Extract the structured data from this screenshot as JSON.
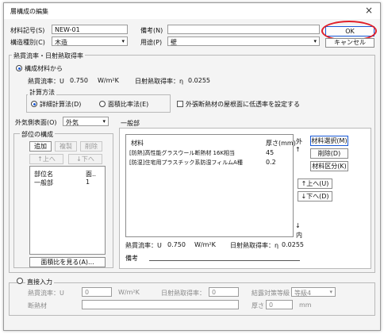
{
  "dialog": {
    "title": "層構成の編集",
    "close_glyph": "×"
  },
  "header": {
    "material_id_label": "材料記号(S)",
    "material_id_value": "NEW-01",
    "notes_label": "備考(N)",
    "notes_value": "",
    "structure_label": "構造種別(C)",
    "structure_value": "木造",
    "usage_label": "用途(P)",
    "usage_value": "壁",
    "ok_label": "OK",
    "cancel_label": "キャンセル"
  },
  "thermal": {
    "group_label": "熱貫流率・日射熱取得率",
    "from_composition_label": "構成材料から",
    "u_label": "熱貫流率：U",
    "u_value": "0.750",
    "u_unit": "W/m²K",
    "eta_label": "日射熱取得率：η",
    "eta_value": "0.0255",
    "calc_group_label": "計算方法",
    "calc_detail_label": "詳細計算法(D)",
    "calc_area_label": "面積比率法(E)",
    "low_perm_label": "外張断熱材の屋根面に低透率を設定する",
    "exterior_label": "外気側表面(O)",
    "exterior_value": "外気"
  },
  "parts": {
    "group_label": "部位の構成",
    "add_label": "追加",
    "copy_label": "複製",
    "delete_label": "削除",
    "up_label": "↑上へ",
    "down_label": "↓下へ",
    "col_name": "部位名",
    "col_area": "面..",
    "rows": [
      {
        "name": "一般部",
        "area": "1"
      }
    ],
    "area_ratio_btn": "面積比を見る(A)..."
  },
  "general": {
    "tab_label": "一般部",
    "col_material": "材料",
    "col_thickness": "厚さ(mm)",
    "rows": [
      {
        "material": "[防熱]高性能グラスウール断熱材 16K相当",
        "thickness": "45"
      },
      {
        "material": "[防湿]住宅用プラスチック系防湿フィルムA種",
        "thickness": "0.2"
      }
    ],
    "outside_label": "外",
    "inside_label": "内",
    "up_arrow": "↑",
    "down_arrow": "↓",
    "select_material_btn": "材料選択(M)",
    "delete_btn": "削除(D)",
    "category_btn": "材料区分(K)",
    "move_up_btn": "↑上へ(U)",
    "move_down_btn": "↓下へ(D)",
    "u_label": "熱貫流率：U",
    "u_value": "0.750",
    "u_unit": "W/m²K",
    "eta_label": "日射熱取得率：η",
    "eta_value": "0.0255",
    "notes_label": "備考",
    "notes_value": ""
  },
  "direct": {
    "radio_label": "直接入力",
    "u_label": "熱貫流率：U",
    "u_value": "0",
    "u_unit": "W/m²K",
    "eta_label": "日射熱取得率：",
    "eta_value": "0",
    "measure_label": "結露対策等級",
    "measure_value": "等級4",
    "insulation_label": "断熱材",
    "thickness_label": "厚さ",
    "thickness_value": "0",
    "thickness_unit": "mm"
  },
  "colors": {
    "accent": "#1a5ad7",
    "highlight_circle": "#e0202a"
  }
}
